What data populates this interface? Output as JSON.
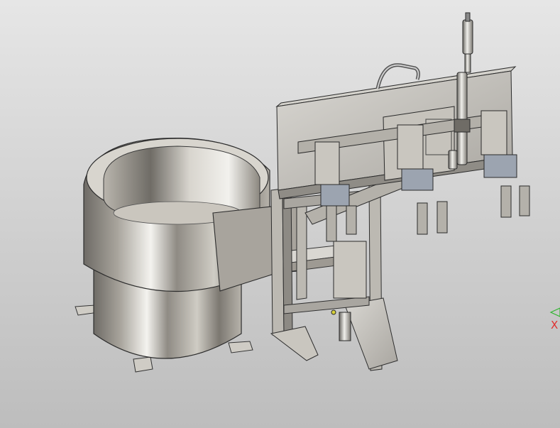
{
  "viewport": {
    "background_top": "#e6e6e6",
    "background_bottom": "#bdbdbd"
  },
  "triad": {
    "x_axis_label": "X",
    "x_axis_color": "#e03030",
    "y_axis_color": "#2fb52f"
  }
}
